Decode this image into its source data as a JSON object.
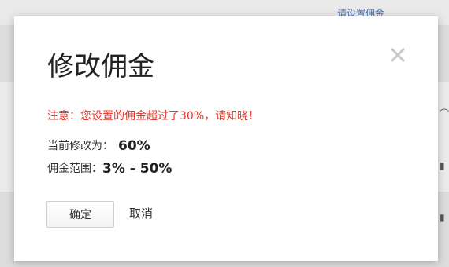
{
  "background": {
    "top_link": "请设置佣金"
  },
  "dialog": {
    "title": "修改佣金",
    "warning": "注意：您设置的佣金超过了30%，请知晓！",
    "current_label": "当前修改为：",
    "current_value": "60%",
    "range_label": "佣金范围：",
    "range_value": "3% - 50%",
    "confirm_label": "确定",
    "cancel_label": "取消"
  },
  "colors": {
    "warning": "#e03a2e",
    "close_icon": "#c8c8c8"
  },
  "icons": {
    "close": "close-icon"
  }
}
